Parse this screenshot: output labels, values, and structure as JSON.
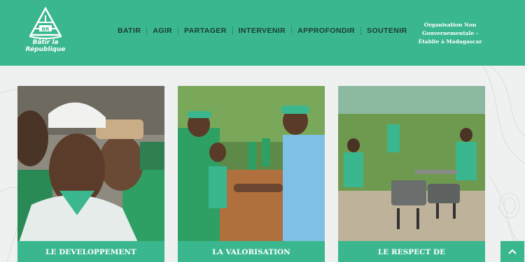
{
  "brand": {
    "logo_mark": "BR",
    "name_line1": "Bâtir la",
    "name_line2": "République"
  },
  "nav": {
    "items": [
      "BATIR",
      "AGIR",
      "PARTAGER",
      "INTERVENIR",
      "APPROFONDIR",
      "SOUTENIR"
    ]
  },
  "tagline": {
    "line1": "Organisation Non",
    "line2": "Gouvernementale -",
    "line3": "Établie à Madagascar"
  },
  "cards": [
    {
      "caption_line1": "LE DEVELOPPEMENT"
    },
    {
      "caption_line1": "LA VALORISATION"
    },
    {
      "caption_line1": "LE RESPECT DE"
    }
  ],
  "colors": {
    "primary": "#3ab78f",
    "nav_text": "#1c3b33",
    "background": "#eef1ef"
  },
  "icons": {
    "scroll_top": "chevron-up-icon"
  }
}
